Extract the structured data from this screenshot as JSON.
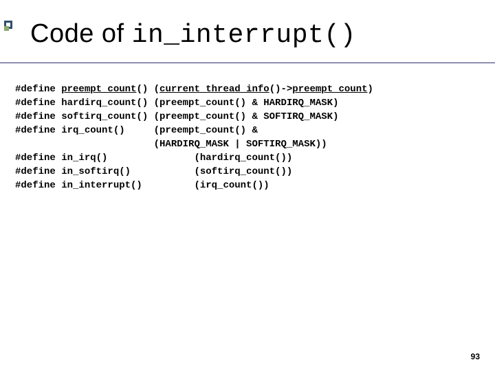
{
  "title": {
    "prefix": "Code of ",
    "mono": "in_interrupt()"
  },
  "code": {
    "lines": [
      "#define preempt_count() (current_thread_info()->preempt_count)",
      "#define hardirq_count() (preempt_count() & HARDIRQ_MASK)",
      "#define softirq_count() (preempt_count() & SOFTIRQ_MASK)",
      "#define irq_count()     (preempt_count() &",
      "                        (HARDIRQ_MASK | SOFTIRQ_MASK))",
      "#define in_irq()               (hardirq_count())",
      "#define in_softirq()           (softirq_count())",
      "#define in_interrupt()         (irq_count())"
    ],
    "underline_tokens": [
      "preempt_count",
      "current_thread_info",
      "preempt_count"
    ]
  },
  "page_number": "93"
}
